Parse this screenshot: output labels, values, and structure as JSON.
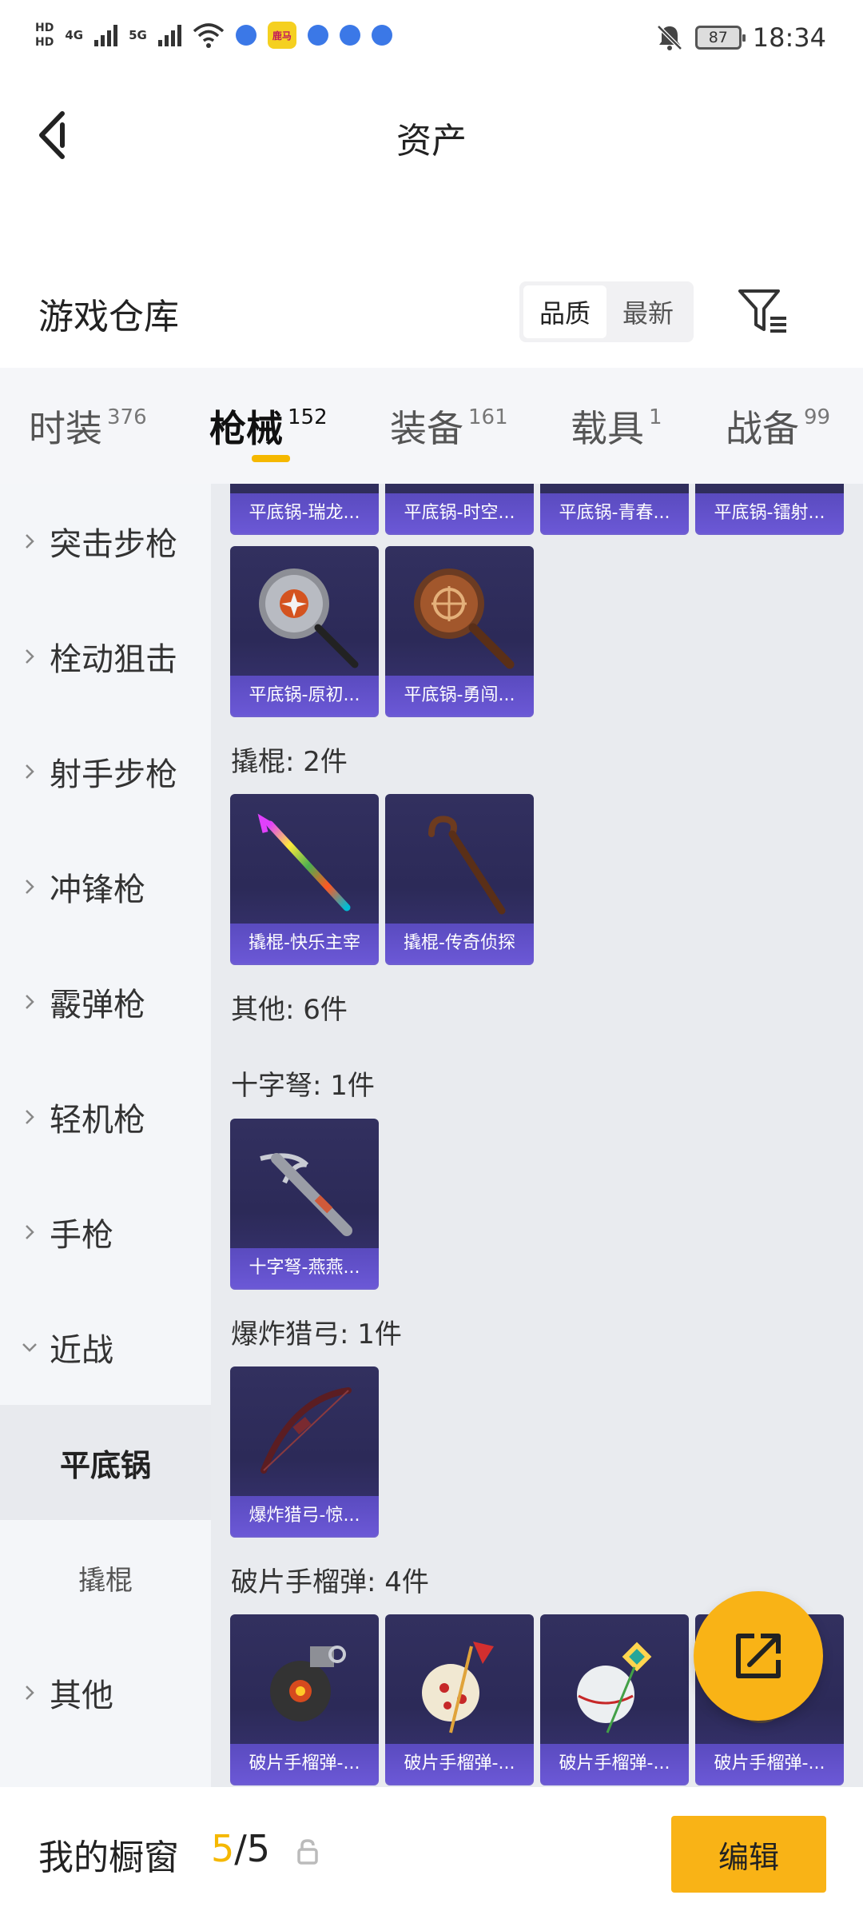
{
  "status_bar": {
    "hd1": "HD",
    "hd2": "HD",
    "net1": "4G",
    "net2": "5G",
    "app_label": "鹿马",
    "battery": "87",
    "time": "18:34"
  },
  "header": {
    "title": "资产"
  },
  "warehouse": {
    "title": "游戏仓库",
    "sort_options": [
      "品质",
      "最新"
    ],
    "active_sort": "品质"
  },
  "tabs": [
    {
      "label": "时装",
      "count": "376"
    },
    {
      "label": "枪械",
      "count": "152"
    },
    {
      "label": "装备",
      "count": "161"
    },
    {
      "label": "载具",
      "count": "1"
    },
    {
      "label": "战备",
      "count": "99"
    }
  ],
  "sidebar": {
    "items": [
      {
        "label": "突击步枪"
      },
      {
        "label": "栓动狙击"
      },
      {
        "label": "射手步枪"
      },
      {
        "label": "冲锋枪"
      },
      {
        "label": "霰弹枪"
      },
      {
        "label": "轻机枪"
      },
      {
        "label": "手枪"
      },
      {
        "label": "近战"
      },
      {
        "label": "平底锅"
      },
      {
        "label": "撬棍"
      },
      {
        "label": "其他"
      }
    ]
  },
  "content": {
    "top_partial_cards": [
      "平底锅-瑞龙...",
      "平底锅-时空...",
      "平底锅-青春...",
      "平底锅-镭射..."
    ],
    "pan_cards": [
      "平底锅-原初...",
      "平底锅-勇闯..."
    ],
    "crowbar_title": "撬棍: 2件",
    "crowbar_cards": [
      "撬棍-快乐主宰",
      "撬棍-传奇侦探"
    ],
    "other_title": "其他: 6件",
    "crossbow_title": "十字弩: 1件",
    "crossbow_cards": [
      "十字弩-燕燕..."
    ],
    "bow_title": "爆炸猎弓: 1件",
    "bow_cards": [
      "爆炸猎弓-惊..."
    ],
    "grenade_title": "破片手榴弹: 4件",
    "grenade_cards": [
      "破片手榴弹-...",
      "破片手榴弹-...",
      "破片手榴弹-...",
      "破片手榴弹-..."
    ]
  },
  "bottom_bar": {
    "label": "我的橱窗",
    "current": "5",
    "separator": "/",
    "total": "5",
    "edit_label": "编辑"
  },
  "colors": {
    "accent": "#f9b316",
    "card_caption": "#6b58d6",
    "card_bg": "#2c2a58"
  }
}
